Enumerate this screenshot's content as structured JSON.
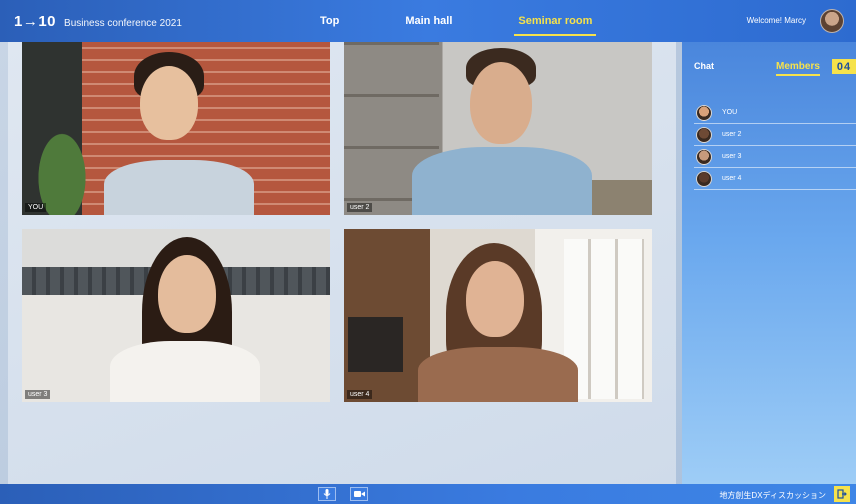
{
  "header": {
    "logo_mark": "1→10",
    "logo_title": "Business conference 2021",
    "nav": [
      {
        "label": "Top"
      },
      {
        "label": "Main hall"
      },
      {
        "label": "Seminar room"
      }
    ],
    "active_nav": "Seminar room",
    "welcome": "Welcome! Marcy"
  },
  "tiles": [
    {
      "label": "YOU"
    },
    {
      "label": "user 2"
    },
    {
      "label": "user 3"
    },
    {
      "label": "user 4"
    }
  ],
  "panel": {
    "chat_tab": "Chat",
    "members_tab": "Members",
    "member_count": "04",
    "members": [
      {
        "name": "YOU",
        "avatar_color": "#d9a27a"
      },
      {
        "name": "user 2",
        "avatar_color": "#6e4a35"
      },
      {
        "name": "user 3",
        "avatar_color": "#c79a7c"
      },
      {
        "name": "user 4",
        "avatar_color": "#5a3b2b"
      }
    ]
  },
  "footer": {
    "text": "地方創生DXディスカッション",
    "icons": [
      "microphone-icon",
      "camera-icon",
      "exit-icon"
    ]
  },
  "colors": {
    "accent": "#f6e24b",
    "bar_blue": "#3a7be0"
  }
}
